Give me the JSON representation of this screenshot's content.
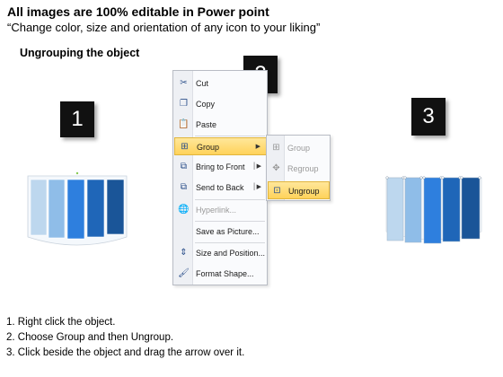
{
  "header": {
    "title": "All images are 100% editable in Power point",
    "subtitle": "“Change color, size and orientation of any icon to your liking”"
  },
  "section_title": "Ungrouping the object",
  "badges": [
    "1",
    "2",
    "3"
  ],
  "context_menu": {
    "items": [
      {
        "label": "Cut",
        "icon": "scissors-icon"
      },
      {
        "label": "Copy",
        "icon": "copy-icon"
      },
      {
        "label": "Paste",
        "icon": "paste-icon"
      },
      {
        "label": "Group",
        "icon": "group-icon",
        "selected": true,
        "has_submenu": true
      },
      {
        "label": "Bring to Front",
        "icon": "bring-front-icon",
        "has_submenu": true
      },
      {
        "label": "Send to Back",
        "icon": "send-back-icon",
        "has_submenu": true
      },
      {
        "label": "Hyperlink...",
        "icon": "hyperlink-icon",
        "disabled": true
      },
      {
        "label": "Save as Picture...",
        "icon": ""
      },
      {
        "label": "Size and Position...",
        "icon": "size-position-icon"
      },
      {
        "label": "Format Shape...",
        "icon": "format-shape-icon"
      }
    ]
  },
  "submenu": {
    "items": [
      {
        "label": "Group",
        "icon": "group-icon",
        "disabled": true
      },
      {
        "label": "Regroup",
        "icon": "regroup-icon",
        "disabled": true
      },
      {
        "label": "Ungroup",
        "icon": "ungroup-icon",
        "selected": true
      }
    ]
  },
  "steps": [
    "1.  Right click the object.",
    "2.  Choose Group and then Ungroup.",
    "3.  Click beside the object and drag the arrow over it."
  ],
  "colors": {
    "bar_light": "#bdd7ee",
    "bar_mid_light": "#8fbde8",
    "bar_mid": "#2e75d6",
    "bar_dark": "#1f5fb0",
    "bar_darkest": "#1a4f94",
    "highlight": "#ffd25a"
  }
}
